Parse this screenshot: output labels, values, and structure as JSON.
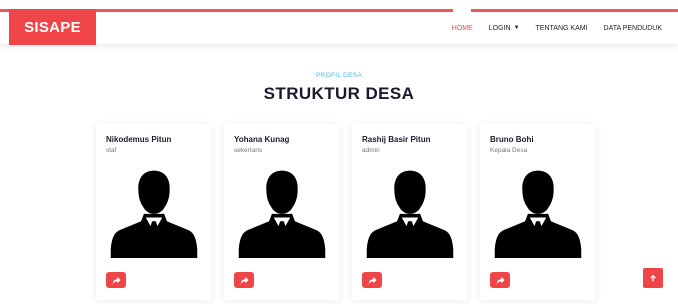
{
  "brand": {
    "name": "SISAPE",
    "accent": "#f04548",
    "sub_color": "#4fb9ea"
  },
  "nav": {
    "items": [
      {
        "label": "HOME",
        "active": true
      },
      {
        "label": "LOGIN",
        "dropdown": true
      },
      {
        "label": "TENTANG KAMI"
      },
      {
        "label": "DATA PENDUDUK"
      }
    ]
  },
  "section": {
    "subtitle": "PROFIL DESA",
    "title": "STRUKTUR DESA"
  },
  "cards": [
    {
      "name": "Nikodemus Pitun",
      "role": "staf"
    },
    {
      "name": "Yohana Kunag",
      "role": "sekertaris"
    },
    {
      "name": "Rashij Basir Pitun",
      "role": "admin"
    },
    {
      "name": "Bruno Bohi",
      "role": "Kepala Desa"
    }
  ],
  "icons": {
    "share": "share-arrow-icon",
    "avatar": "person-silhouette-icon",
    "totop": "arrow-up-icon",
    "dropdown": "chevron-down-icon"
  }
}
